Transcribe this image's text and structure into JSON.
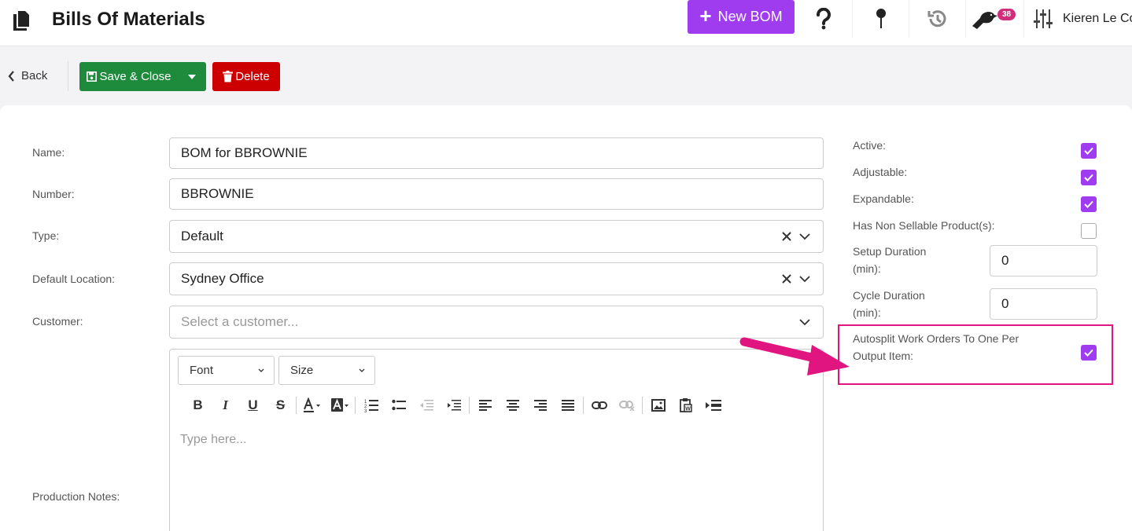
{
  "header": {
    "title": "Bills Of Materials",
    "new_button": "New BOM",
    "notification_count": "38",
    "user_name": "Kieren Le Co"
  },
  "toolbar": {
    "back_label": "Back",
    "save_label": "Save & Close",
    "delete_label": "Delete"
  },
  "form": {
    "name_label": "Name:",
    "name_value": "BOM for BBROWNIE",
    "number_label": "Number:",
    "number_value": "BBROWNIE",
    "type_label": "Type:",
    "type_value": "Default",
    "location_label": "Default Location:",
    "location_value": "Sydney Office",
    "customer_label": "Customer:",
    "customer_placeholder": "Select a customer...",
    "notes_label": "Production Notes:"
  },
  "editor": {
    "font_label": "Font",
    "size_label": "Size",
    "placeholder": "Type here..."
  },
  "options": {
    "active_label": "Active:",
    "active_checked": true,
    "adjustable_label": "Adjustable:",
    "adjustable_checked": true,
    "expandable_label": "Expandable:",
    "expandable_checked": true,
    "non_sellable_label": "Has Non Sellable Product(s):",
    "non_sellable_checked": false,
    "setup_label_line1": "Setup Duration",
    "setup_label_line2": "(min):",
    "setup_value": "0",
    "cycle_label_line1": "Cycle Duration",
    "cycle_label_line2": "(min):",
    "cycle_value": "0",
    "autosplit_label_line1": "Autosplit Work Orders To One Per",
    "autosplit_label_line2": "Output Item:",
    "autosplit_checked": true
  },
  "colors": {
    "accent": "#9f3cf0",
    "save": "#1e8a3c",
    "delete": "#cc0000",
    "highlight": "#e0157f"
  }
}
